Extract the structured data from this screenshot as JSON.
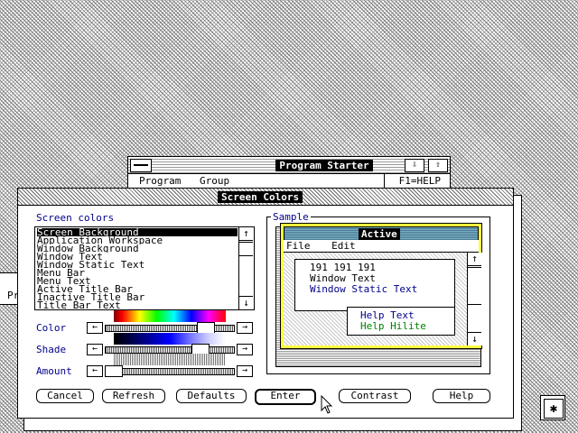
{
  "program_starter": {
    "title": "Program Starter",
    "menu": [
      "Program",
      "Group"
    ],
    "help": "F1=HELP",
    "scroll_down": "⇩",
    "scroll_up": "⇧"
  },
  "background_window": {
    "label": "Pr"
  },
  "dialog": {
    "title": "Screen Colors",
    "screen_colors_label": "Screen colors",
    "items": [
      "Screen Background",
      "Application Workspace",
      "Window Background",
      "Window Text",
      "Window Static Text",
      "Menu Bar",
      "Menu Text",
      "Active Title Bar",
      "Inactive Title Bar",
      "Title Bar Text"
    ],
    "selected_index": 0,
    "list_scroll_up": "↑",
    "list_scroll_down": "↓",
    "color_label": "Color",
    "shade_label": "Shade",
    "amount_label": "Amount",
    "arrow_left": "←",
    "arrow_right": "→"
  },
  "sample": {
    "label": "Sample",
    "active_title": "Active",
    "menu": [
      "File",
      "Edit"
    ],
    "rgb_text": "191 191 191",
    "window_text": "Window Text",
    "window_static_text": "Window Static Text",
    "help_text": "Help Text",
    "help_hilite": "Help Hilite",
    "scroll_up": "↑",
    "scroll_down": "↓"
  },
  "buttons": {
    "cancel": "Cancel",
    "refresh": "Refresh",
    "defaults": "Defaults",
    "enter": "Enter",
    "contrast": "Contrast",
    "help": "Help"
  },
  "colors": {
    "static_text": "#00008c",
    "help_hilite": "#008000",
    "active_border": "#ffff40",
    "caption": "#7ab0c8"
  }
}
